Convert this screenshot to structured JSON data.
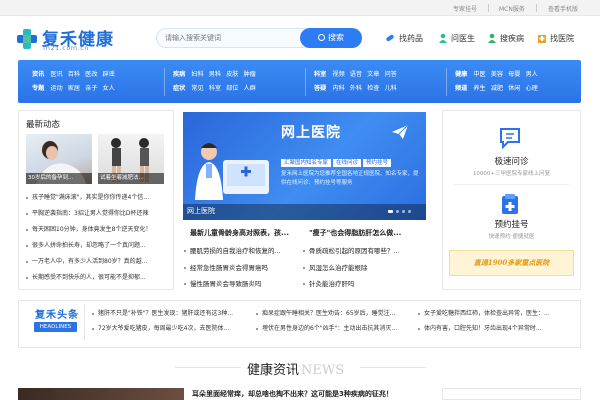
{
  "topbar": {
    "links": [
      "专家挂号",
      "MCN服务",
      "查看手机版"
    ]
  },
  "logo": {
    "name": "复禾健康",
    "domain": "fh21.com.cn"
  },
  "search": {
    "placeholder": "请输入搜索关键词",
    "button_label": "搜索"
  },
  "quick_links": [
    "找药品",
    "问医生",
    "搜疾病",
    "找医院"
  ],
  "nav": {
    "group1": {
      "row1": [
        "资讯",
        "医讯",
        "百科",
        "医改",
        "辟谣"
      ],
      "row2": [
        "专题",
        "运动",
        "家居",
        "亲子",
        "女人"
      ]
    },
    "group2": {
      "row1": [
        "疾病",
        "妇科",
        "男科",
        "皮肤",
        "肿瘤"
      ],
      "row2": [
        "症状",
        "常见",
        "科室",
        "部位",
        "人群"
      ]
    },
    "group3": {
      "row1": [
        "科室",
        "视频",
        "语音",
        "文章",
        "问答"
      ],
      "row2": [
        "答疑",
        "内科",
        "外科",
        "检查",
        "儿科"
      ]
    },
    "group4": {
      "row1": [
        "健康",
        "中医",
        "美容",
        "母婴",
        "男人"
      ],
      "row2": [
        "频道",
        "养生",
        "减肥",
        "休闲",
        "心理"
      ]
    }
  },
  "latest": {
    "title": "最新动态",
    "thumbs": [
      "30岁后的备孕到...",
      "试着坐着减肥法..."
    ],
    "items": [
      "孩子睡觉\"满床滚\"，其实是你你传递4个信...",
      "平胸逆袭指南：3招让男人觉得你比D杯还辣",
      "每天困困10分钟，身体竟发生8个逆天变化！",
      "很多人拼命拍长寿，却忽略了一个真问题...",
      "一万老人中，有多少人活到80岁？真的越...",
      "长期感受不到快乐的人，很可能不是抑郁..."
    ]
  },
  "banner": {
    "title": "网上医院",
    "tags": [
      "汇聚国内知名专家",
      "在线问诊",
      "预约挂号"
    ],
    "desc": "复禾网上医院为您推荐全国各地正规医院、知名专家，提供在线问诊、预约挂号等服务",
    "caption": "网上医院"
  },
  "focus": {
    "headlines": [
      "最新儿童骨龄身高对照表，孩...",
      "\"瘦子\"也会得脂肪肝怎么做..."
    ],
    "items_left": [
      "腰肌劳损的自我治疗和恢复的...",
      "经常急性肠胃炎会得胃癌吗",
      "慢性肠胃炎会导致肠炎吗"
    ],
    "items_right": [
      "骨质疏松引起的原因有哪些？...",
      "风湿怎么治疗能根除",
      "针灸能治疗肝吗"
    ]
  },
  "services": {
    "consult": {
      "title": "极速问诊",
      "sub": "10000+三甲医院专家线上问复"
    },
    "booking": {
      "title": "预约挂号",
      "sub": "快速预约  便捷就医"
    },
    "ad": "直通1900多家重点医院"
  },
  "headlines": {
    "title": "复禾头条",
    "badge": "HEADLINES",
    "rows": [
      [
        "猪肝不只是\"补铁\"？医生发现：猪肝或还有这3种...",
        "痴呆症跟午睡相关？医生劝告：65岁后，睡觉注...",
        "女子爱吃糖拌西红柿，体检查出异常，医生：..."
      ],
      [
        "72岁大爷爱吃猪皮，每周最少吃4次，去医院体...",
        "埋伏在男性身边的6个\"凶手\"：主动出击抗其消灭...",
        "体内有害，口腔先知！牙齿出现4个异常时..."
      ]
    ]
  },
  "section": {
    "title": "健康资讯",
    "title_en": "NEWS"
  },
  "article": {
    "title": "耳朵里面经常痒，却总啥也掏不出来？这可能是3种疾病的征兆！"
  }
}
